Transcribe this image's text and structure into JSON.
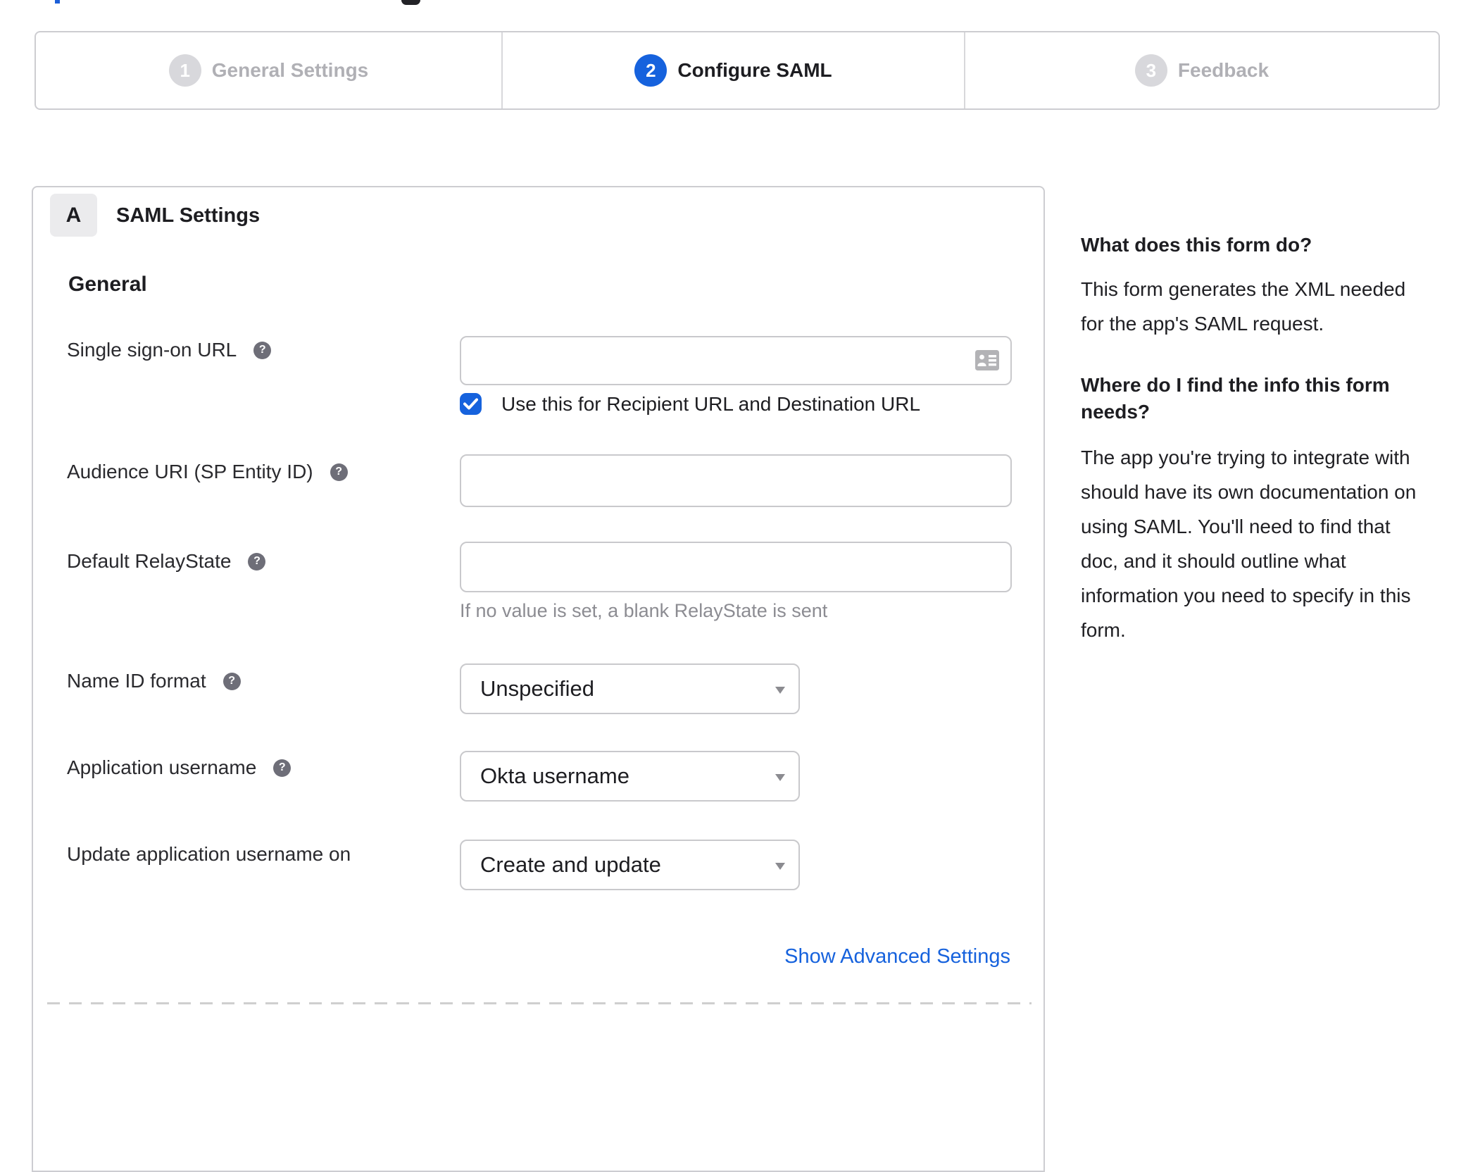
{
  "stepper": {
    "steps": [
      {
        "number": "1",
        "label": "General Settings",
        "active": false
      },
      {
        "number": "2",
        "label": "Configure SAML",
        "active": true
      },
      {
        "number": "3",
        "label": "Feedback",
        "active": false
      }
    ]
  },
  "form": {
    "section_badge": "A",
    "section_title": "SAML Settings",
    "group_heading": "General",
    "fields": {
      "sso": {
        "label": "Single sign-on URL",
        "value": "",
        "checkbox_label": "Use this for Recipient URL and Destination URL",
        "checkbox_checked": true
      },
      "audience": {
        "label": "Audience URI (SP Entity ID)",
        "value": ""
      },
      "relay": {
        "label": "Default RelayState",
        "value": "",
        "helper": "If no value is set, a blank RelayState is sent"
      },
      "name_id": {
        "label": "Name ID format",
        "value": "Unspecified"
      },
      "app_username": {
        "label": "Application username",
        "value": "Okta username"
      },
      "update_username": {
        "label": "Update application username on",
        "value": "Create and update"
      }
    },
    "advanced_link": "Show Advanced Settings"
  },
  "sidebar": {
    "q1": "What does this form do?",
    "a1": "This form generates the XML needed\nfor the app's SAML request.",
    "q2": "Where do I find the info this form\nneeds?",
    "a2": "The app you're trying to integrate with\nshould have its own documentation on\nusing SAML. You'll need to find that\ndoc, and it should outline what\ninformation you need to specify in this\nform."
  },
  "colors": {
    "accent_blue": "#1662dd",
    "inactive_gray": "#b0b0b5",
    "border": "#cdcdd1"
  }
}
